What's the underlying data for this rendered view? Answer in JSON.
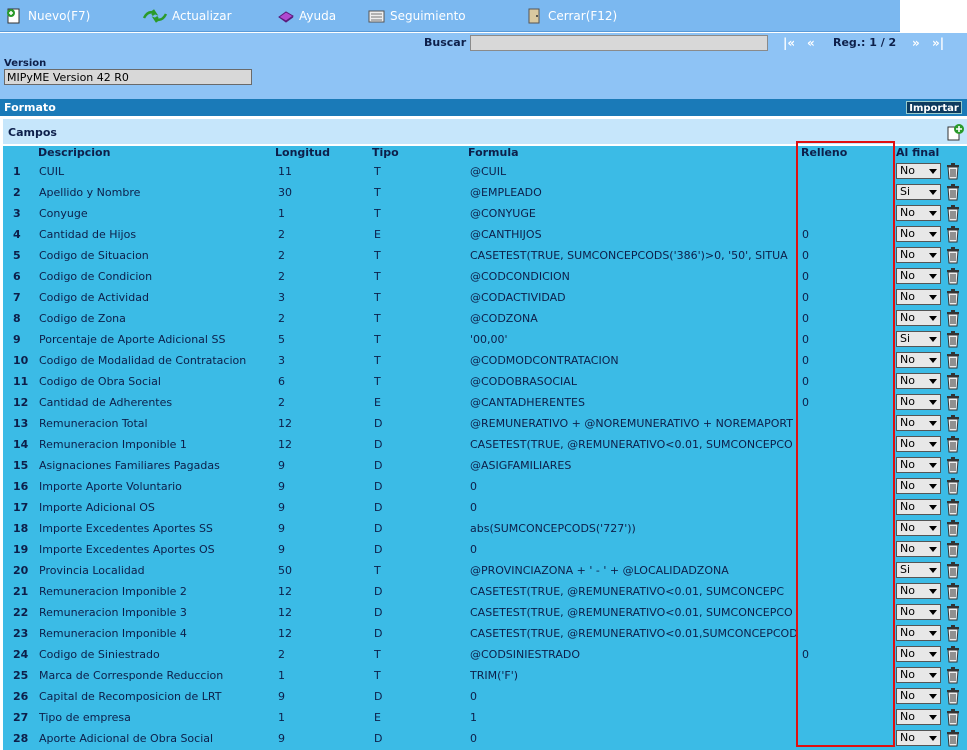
{
  "toolbar": {
    "nuevo": "Nuevo(F7)",
    "actualizar": "Actualizar",
    "ayuda": "Ayuda",
    "seguimiento": "Seguimiento",
    "cerrar": "Cerrar(F12)"
  },
  "search": {
    "label": "Buscar",
    "value": "",
    "first": "|«",
    "prev": "«",
    "reg": "Reg.: 1 / 2",
    "next": "»",
    "last": "»|"
  },
  "version": {
    "label": "Version",
    "value": "MIPyME Version 42 R0"
  },
  "formato": {
    "label": "Formato",
    "importar": "Importar"
  },
  "campos": {
    "label": "Campos",
    "headers": {
      "descripcion": "Descripcion",
      "longitud": "Longitud",
      "tipo": "Tipo",
      "formula": "Formula",
      "relleno": "Relleno",
      "alfinal": "Al final"
    },
    "rows": [
      {
        "n": "1",
        "desc": "CUIL",
        "len": "11",
        "tipo": "T",
        "formula": "@CUIL",
        "relleno": "",
        "alfinal": "No"
      },
      {
        "n": "2",
        "desc": "Apellido y Nombre",
        "len": "30",
        "tipo": "T",
        "formula": "@EMPLEADO",
        "relleno": "",
        "alfinal": "Si"
      },
      {
        "n": "3",
        "desc": "Conyuge",
        "len": "1",
        "tipo": "T",
        "formula": "@CONYUGE",
        "relleno": "",
        "alfinal": "No"
      },
      {
        "n": "4",
        "desc": "Cantidad de Hijos",
        "len": "2",
        "tipo": "E",
        "formula": "@CANTHIJOS",
        "relleno": "0",
        "alfinal": "No"
      },
      {
        "n": "5",
        "desc": "Codigo de Situacion",
        "len": "2",
        "tipo": "T",
        "formula": "CASETEST(TRUE,  SUMCONCEPCODS('386')>0, '50', SITUA",
        "relleno": "0",
        "alfinal": "No"
      },
      {
        "n": "6",
        "desc": "Codigo de Condicion",
        "len": "2",
        "tipo": "T",
        "formula": "@CODCONDICION",
        "relleno": "0",
        "alfinal": "No"
      },
      {
        "n": "7",
        "desc": "Codigo de Actividad",
        "len": "3",
        "tipo": "T",
        "formula": "@CODACTIVIDAD",
        "relleno": "0",
        "alfinal": "No"
      },
      {
        "n": "8",
        "desc": "Codigo de Zona",
        "len": "2",
        "tipo": "T",
        "formula": "@CODZONA",
        "relleno": "0",
        "alfinal": "No"
      },
      {
        "n": "9",
        "desc": "Porcentaje de Aporte Adicional SS",
        "len": "5",
        "tipo": "T",
        "formula": "'00,00'",
        "relleno": "0",
        "alfinal": "Si"
      },
      {
        "n": "10",
        "desc": "Codigo de Modalidad de Contratacion",
        "len": "3",
        "tipo": "T",
        "formula": "@CODMODCONTRATACION",
        "relleno": "0",
        "alfinal": "No"
      },
      {
        "n": "11",
        "desc": "Codigo de Obra Social",
        "len": "6",
        "tipo": "T",
        "formula": "@CODOBRASOCIAL",
        "relleno": "0",
        "alfinal": "No"
      },
      {
        "n": "12",
        "desc": "Cantidad de Adherentes",
        "len": "2",
        "tipo": "E",
        "formula": "@CANTADHERENTES",
        "relleno": "0",
        "alfinal": "No"
      },
      {
        "n": "13",
        "desc": "Remuneracion Total",
        "len": "12",
        "tipo": "D",
        "formula": "@REMUNERATIVO + @NOREMUNERATIVO + NOREMAPORT",
        "relleno": "",
        "alfinal": "No"
      },
      {
        "n": "14",
        "desc": "Remuneracion Imponible 1",
        "len": "12",
        "tipo": "D",
        "formula": "CASETEST(TRUE, @REMUNERATIVO<0.01, SUMCONCEPCO",
        "relleno": "",
        "alfinal": "No"
      },
      {
        "n": "15",
        "desc": "Asignaciones Familiares Pagadas",
        "len": "9",
        "tipo": "D",
        "formula": "@ASIGFAMILIARES",
        "relleno": "",
        "alfinal": "No"
      },
      {
        "n": "16",
        "desc": "Importe Aporte Voluntario",
        "len": "9",
        "tipo": "D",
        "formula": "0",
        "relleno": "",
        "alfinal": "No"
      },
      {
        "n": "17",
        "desc": "Importe Adicional OS",
        "len": "9",
        "tipo": "D",
        "formula": "0",
        "relleno": "",
        "alfinal": "No"
      },
      {
        "n": "18",
        "desc": "Importe Excedentes Aportes SS",
        "len": "9",
        "tipo": "D",
        "formula": "abs(SUMCONCEPCODS('727'))",
        "relleno": "",
        "alfinal": "No"
      },
      {
        "n": "19",
        "desc": "Importe Excedentes Aportes OS",
        "len": "9",
        "tipo": "D",
        "formula": "0",
        "relleno": "",
        "alfinal": "No"
      },
      {
        "n": "20",
        "desc": "Provincia Localidad",
        "len": "50",
        "tipo": "T",
        "formula": "@PROVINCIAZONA + ' - ' + @LOCALIDADZONA",
        "relleno": "",
        "alfinal": "Si"
      },
      {
        "n": "21",
        "desc": "Remuneracion Imponible 2",
        "len": "12",
        "tipo": "D",
        "formula": " CASETEST(TRUE, @REMUNERATIVO<0.01, SUMCONCEPC",
        "relleno": "",
        "alfinal": "No"
      },
      {
        "n": "22",
        "desc": "Remuneracion Imponible 3",
        "len": "12",
        "tipo": "D",
        "formula": "CASETEST(TRUE, @REMUNERATIVO<0.01, SUMCONCEPCO",
        "relleno": "",
        "alfinal": "No"
      },
      {
        "n": "23",
        "desc": "Remuneracion Imponible 4",
        "len": "12",
        "tipo": "D",
        "formula": "CASETEST(TRUE, @REMUNERATIVO<0.01,SUMCONCEPCOD",
        "relleno": "",
        "alfinal": "No"
      },
      {
        "n": "24",
        "desc": "Codigo de Siniestrado",
        "len": "2",
        "tipo": "T",
        "formula": "@CODSINIESTRADO",
        "relleno": "0",
        "alfinal": "No"
      },
      {
        "n": "25",
        "desc": "Marca de Corresponde Reduccion",
        "len": "1",
        "tipo": "T",
        "formula": "TRIM('F')",
        "relleno": "",
        "alfinal": "No"
      },
      {
        "n": "26",
        "desc": "Capital de Recomposicion de LRT",
        "len": "9",
        "tipo": "D",
        "formula": "0",
        "relleno": "",
        "alfinal": "No"
      },
      {
        "n": "27",
        "desc": "Tipo de empresa",
        "len": "1",
        "tipo": "E",
        "formula": "1",
        "relleno": "",
        "alfinal": "No"
      },
      {
        "n": "28",
        "desc": "Aporte Adicional de Obra Social",
        "len": "9",
        "tipo": "D",
        "formula": "0",
        "relleno": "",
        "alfinal": "No"
      }
    ]
  },
  "colors": {
    "toolbar": "#7bb8f0",
    "grid": "#3bbbe6",
    "formato_band": "#1a7ab8",
    "highlight": "#e01010"
  }
}
